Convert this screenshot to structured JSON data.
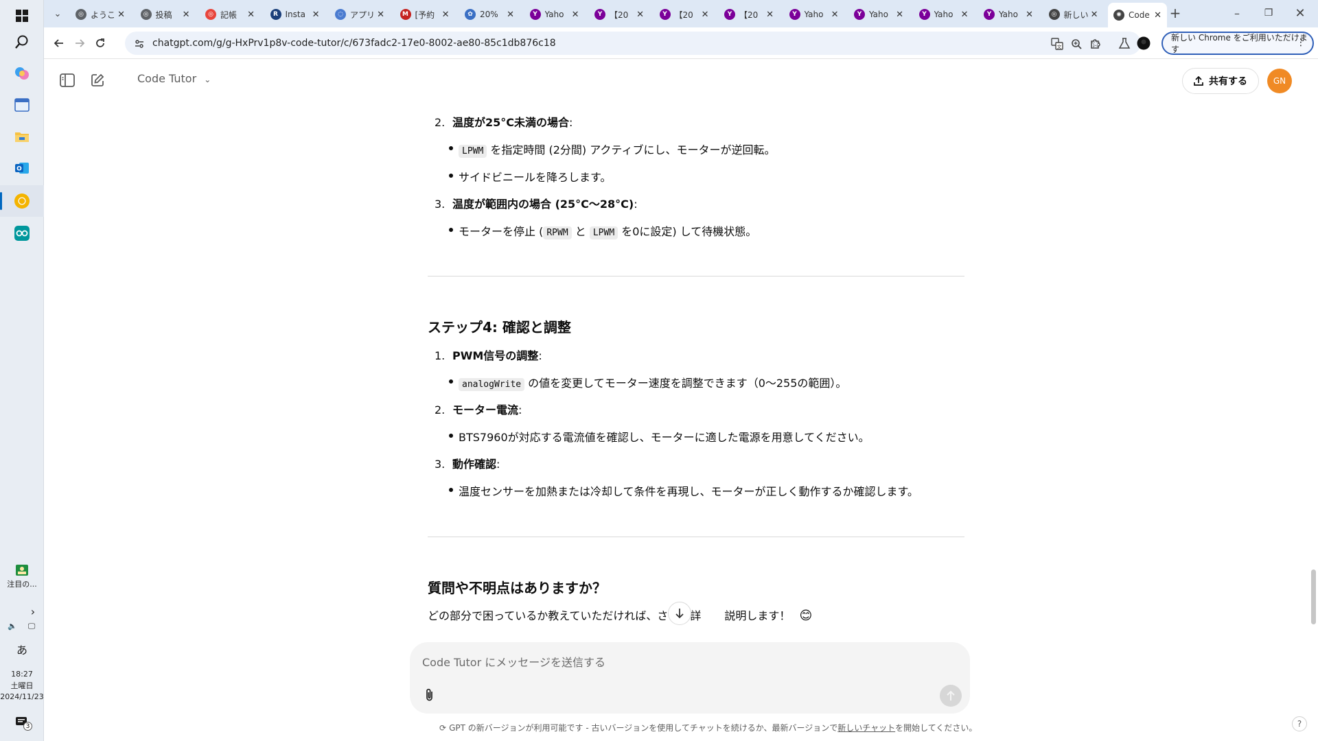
{
  "taskbar": {
    "widget_label": "注目の...",
    "ime": "あ",
    "time": "18:27",
    "weekday": "土曜日",
    "date": "2024/11/23",
    "notification_count": "3"
  },
  "tabs": [
    {
      "title": "ようこ",
      "color": "#5f6368",
      "glyph": "◎"
    },
    {
      "title": "投稿",
      "color": "#5f6368",
      "glyph": "◎"
    },
    {
      "title": "記帳",
      "color": "#e8453c",
      "glyph": "◎"
    },
    {
      "title": "Insta",
      "color": "#1a3e7a",
      "glyph": "R"
    },
    {
      "title": "アプリ",
      "color": "#4a7bd0",
      "glyph": "◌"
    },
    {
      "title": "[予約",
      "color": "#c5221f",
      "glyph": "M"
    },
    {
      "title": "20%",
      "color": "#3a6fc4",
      "glyph": "✿"
    },
    {
      "title": "Yaho",
      "color": "#7b0099",
      "glyph": "Y"
    },
    {
      "title": "【20",
      "color": "#7b0099",
      "glyph": "Y"
    },
    {
      "title": "【20",
      "color": "#7b0099",
      "glyph": "Y"
    },
    {
      "title": "【20",
      "color": "#7b0099",
      "glyph": "Y"
    },
    {
      "title": "Yaho",
      "color": "#7b0099",
      "glyph": "Y"
    },
    {
      "title": "Yaho",
      "color": "#7b0099",
      "glyph": "Y"
    },
    {
      "title": "Yaho",
      "color": "#7b0099",
      "glyph": "Y"
    },
    {
      "title": "Yaho",
      "color": "#7b0099",
      "glyph": "Y"
    },
    {
      "title": "新しい",
      "color": "#444444",
      "glyph": "◎"
    },
    {
      "title": "Code",
      "color": "#444444",
      "glyph": "✺"
    }
  ],
  "address": {
    "url": "chatgpt.com/g/g-HxPrv1p8v-code-tutor/c/673fadc2-17e0-8002-ae80-85c1db876c18"
  },
  "chrome_promo": "新しい Chrome をご利用いただけます",
  "header": {
    "gpt_name": "Code Tutor",
    "share_label": "共有する",
    "avatar_initials": "GN"
  },
  "content": {
    "item2": {
      "num": "2.",
      "label": "温度が25°C未満の場合",
      "colon": ":"
    },
    "item2_b1": {
      "code": "LPWM",
      "text": " を指定時間 (2分間) アクティブにし、モーターが逆回転。"
    },
    "item2_b2": {
      "text": "サイドビニールを降ろします。"
    },
    "item3": {
      "num": "3.",
      "label": "温度が範囲内の場合 (25°C〜28°C)",
      "colon": ":"
    },
    "item3_b1": {
      "pre": "モーターを停止 (",
      "code1": "RPWM",
      "mid": " と ",
      "code2": "LPWM",
      "post": " を0に設定) して待機状態。"
    },
    "step4_heading": "ステップ4: 確認と調整",
    "s4_item1": {
      "num": "1.",
      "label": "PWM信号の調整",
      "colon": ":"
    },
    "s4_item1_b1": {
      "code": "analogWrite",
      "text": " の値を変更してモーター速度を調整できます（0〜255の範囲）。"
    },
    "s4_item2": {
      "num": "2.",
      "label": "モーター電流",
      "colon": ":"
    },
    "s4_item2_b1": {
      "text": "BTS7960が対応する電流値を確認し、モーターに適した電源を用意してください。"
    },
    "s4_item3": {
      "num": "3.",
      "label": "動作確認",
      "colon": ":"
    },
    "s4_item3_b1": {
      "text": "温度センサーを加熱または冷却して条件を再現し、モーターが正しく動作するか確認します。"
    },
    "question_heading": "質問や不明点はありますか？",
    "closing_pre": "どの部分で困っているか教えていただければ、さらに詳",
    "closing_post": "説明します！",
    "emoji": "😊"
  },
  "composer": {
    "placeholder": "Code Tutor にメッセージを送信する"
  },
  "footer": {
    "pre": "GPT の新バージョンが利用可能です - 古いバージョンを使用してチャットを続けるか、最新バージョンで",
    "link": "新しいチャット",
    "post": "を開始してください。"
  },
  "help_label": "?"
}
